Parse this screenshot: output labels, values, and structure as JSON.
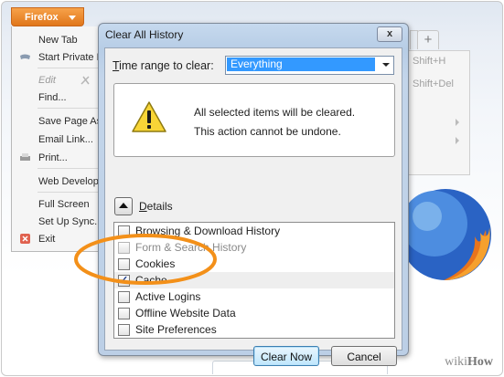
{
  "firefox_menu": {
    "button_label": "Firefox",
    "items": [
      {
        "label": "New Tab"
      },
      {
        "label": "Start Private B"
      },
      {
        "label": "Edit"
      },
      {
        "label": "Find..."
      },
      {
        "label": "Save Page As..."
      },
      {
        "label": "Email Link..."
      },
      {
        "label": "Print..."
      },
      {
        "label": "Web Develope"
      },
      {
        "label": "Full Screen"
      },
      {
        "label": "Set Up Sync..."
      },
      {
        "label": "Exit"
      }
    ]
  },
  "right_menu": {
    "shortcut1": "Shift+H",
    "shortcut2": "Shift+Del"
  },
  "tab": {
    "new_tab_label": "+"
  },
  "dialog": {
    "title": "Clear All History",
    "close_label": "x",
    "time_range_label_prefix": "T",
    "time_range_label_rest": "ime range to clear:",
    "time_range_value": "Everything",
    "warning_line1": "All selected items will be cleared.",
    "warning_line2": "This action cannot be undone.",
    "details_label_prefix": "D",
    "details_label_rest": "etails",
    "items": [
      {
        "label": "Browsing & Download History",
        "checked": false,
        "disabled": false
      },
      {
        "label": "Form & Search History",
        "checked": false,
        "disabled": true
      },
      {
        "label": "Cookies",
        "checked": false,
        "disabled": false
      },
      {
        "label": "Cache",
        "checked": true,
        "disabled": false
      },
      {
        "label": "Active Logins",
        "checked": false,
        "disabled": false
      },
      {
        "label": "Offline Website Data",
        "checked": false,
        "disabled": false
      },
      {
        "label": "Site Preferences",
        "checked": false,
        "disabled": false
      }
    ],
    "clear_now_label": "Clear Now",
    "cancel_label": "Cancel"
  },
  "annotation": {
    "color": "#f39019"
  },
  "watermark": {
    "prefix": "wiki",
    "suffix": "How"
  },
  "colors": {
    "firefox_orange": "#e0761a",
    "selection_blue": "#3399ff"
  }
}
